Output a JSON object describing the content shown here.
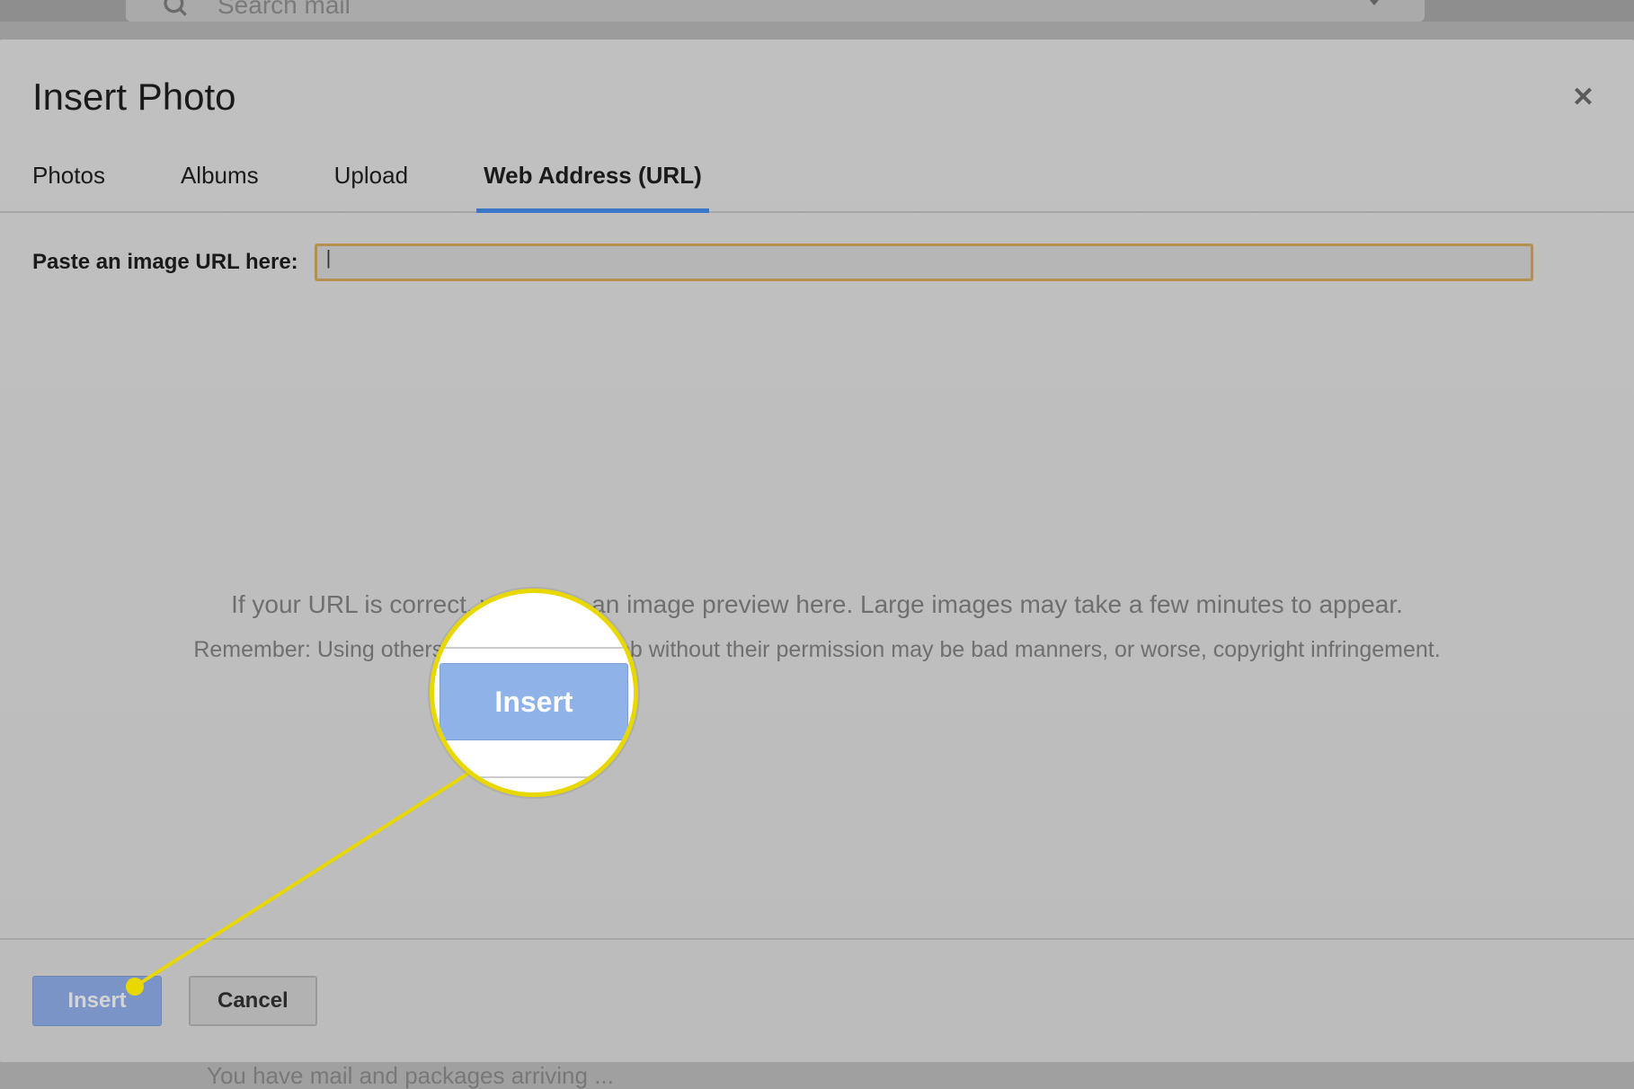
{
  "gmail": {
    "search_placeholder": "Search mail",
    "bottom_text": "You have mail and packages arriving ..."
  },
  "modal": {
    "title": "Insert Photo",
    "tabs": {
      "photos": "Photos",
      "albums": "Albums",
      "upload": "Upload",
      "url": "Web Address (URL)"
    },
    "url_label": "Paste an image URL here:",
    "preview_line1": "If your URL is correct, you'll see an image preview here. Large images may take a few minutes to appear.",
    "preview_line2": "Remember: Using others' images on the web without their permission may be bad manners, or worse, copyright infringement.",
    "insert_button": "Insert",
    "cancel_button": "Cancel"
  },
  "annotation": {
    "magnify_label": "Insert"
  }
}
